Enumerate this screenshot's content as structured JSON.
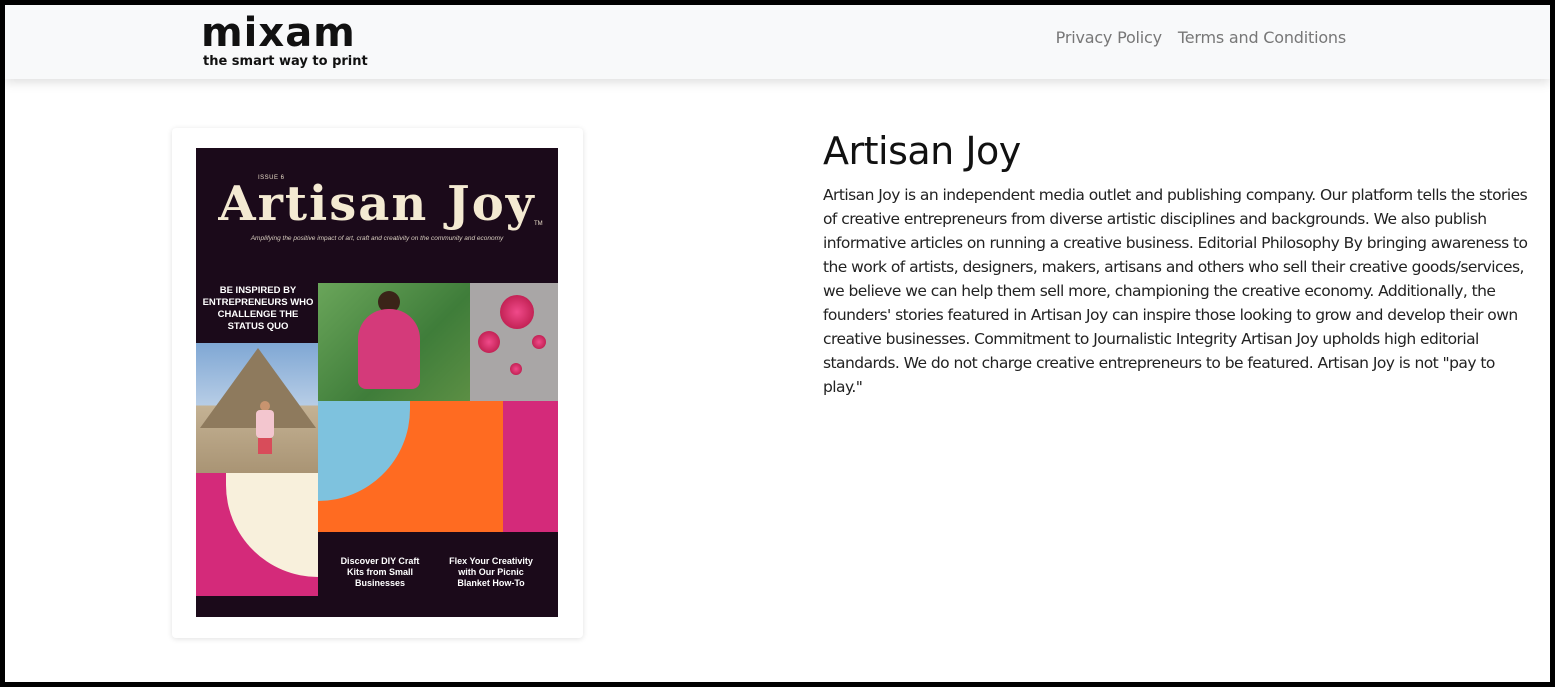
{
  "brand": {
    "logo_text": "mixam",
    "tagline": "the smart way to print"
  },
  "nav": {
    "links": [
      "Privacy Policy",
      "Terms and Conditions"
    ]
  },
  "product": {
    "title": "Artisan Joy",
    "description": "Artisan Joy is an independent media outlet and publishing company. Our platform tells the stories of creative entrepreneurs from diverse artistic disciplines and backgrounds. We also publish informative articles on running a creative business.  Editorial Philosophy By bringing awareness to the work of artists, designers, makers, artisans and others who sell their creative goods/services, we believe we can help them sell more, championing the creative economy. Additionally, the founders' stories featured in Artisan Joy can inspire those looking to grow and develop their own creative businesses.  Commitment to Journalistic Integrity Artisan Joy upholds high editorial standards. We do not charge creative entrepreneurs to be featured. Artisan Joy is not \"pay to play.\""
  },
  "cover": {
    "issue": "ISSUE 6",
    "title": "Artisan Joy",
    "tm": "TM",
    "subtitle": "Amplifying the positive impact of art, craft and creativity on the community and economy",
    "headline": "BE INSPIRED BY ENTREPRENEURS WHO CHALLENGE THE STATUS QUO",
    "blurb_1": "Discover DIY Craft Kits from Small Businesses",
    "blurb_2": "Flex Your Creativity with Our Picnic Blanket How-To"
  },
  "colors": {
    "cover_bg": "#1b0a1a",
    "pink": "#d42a7a",
    "orange": "#ff6b21",
    "blue": "#7ec2de",
    "cream": "#f8f0dc"
  }
}
